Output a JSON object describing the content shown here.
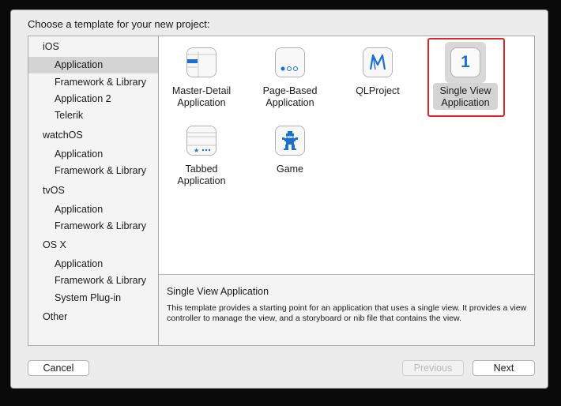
{
  "dialog": {
    "prompt": "Choose a template for your new project:"
  },
  "sidebar": {
    "items": [
      {
        "label": "iOS",
        "level": "head"
      },
      {
        "label": "Application",
        "level": "sub",
        "selected": true
      },
      {
        "label": "Framework & Library",
        "level": "sub"
      },
      {
        "label": "Application 2",
        "level": "sub"
      },
      {
        "label": "Telerik",
        "level": "sub"
      },
      {
        "label": "watchOS",
        "level": "head"
      },
      {
        "label": "Application",
        "level": "sub"
      },
      {
        "label": "Framework & Library",
        "level": "sub"
      },
      {
        "label": "tvOS",
        "level": "head"
      },
      {
        "label": "Application",
        "level": "sub"
      },
      {
        "label": "Framework & Library",
        "level": "sub"
      },
      {
        "label": "OS X",
        "level": "head"
      },
      {
        "label": "Application",
        "level": "sub"
      },
      {
        "label": "Framework & Library",
        "level": "sub"
      },
      {
        "label": "System Plug-in",
        "level": "sub"
      },
      {
        "label": "Other",
        "level": "head"
      }
    ]
  },
  "templates": [
    {
      "line1": "Master-Detail",
      "line2": "Application",
      "icon": "master-detail-icon"
    },
    {
      "line1": "Page-Based",
      "line2": "Application",
      "icon": "page-based-icon"
    },
    {
      "line1": "QLProject",
      "line2": "",
      "icon": "qlproject-icon"
    },
    {
      "line1": "Single View",
      "line2": "Application",
      "icon": "single-view-icon",
      "selected": true
    },
    {
      "line1": "Tabbed",
      "line2": "Application",
      "icon": "tabbed-icon"
    },
    {
      "line1": "Game",
      "line2": "",
      "icon": "game-icon"
    }
  ],
  "description": {
    "title": "Single View Application",
    "text": "This template provides a starting point for an application that uses a single view. It provides a view controller to manage the view, and a storyboard or nib file that contains the view."
  },
  "single_view_glyph": "1",
  "buttons": {
    "cancel": "Cancel",
    "previous": "Previous",
    "next": "Next"
  },
  "colors": {
    "highlight": "#e0262c",
    "accent": "#1a6fd4",
    "selection": "#d4d4d4"
  }
}
